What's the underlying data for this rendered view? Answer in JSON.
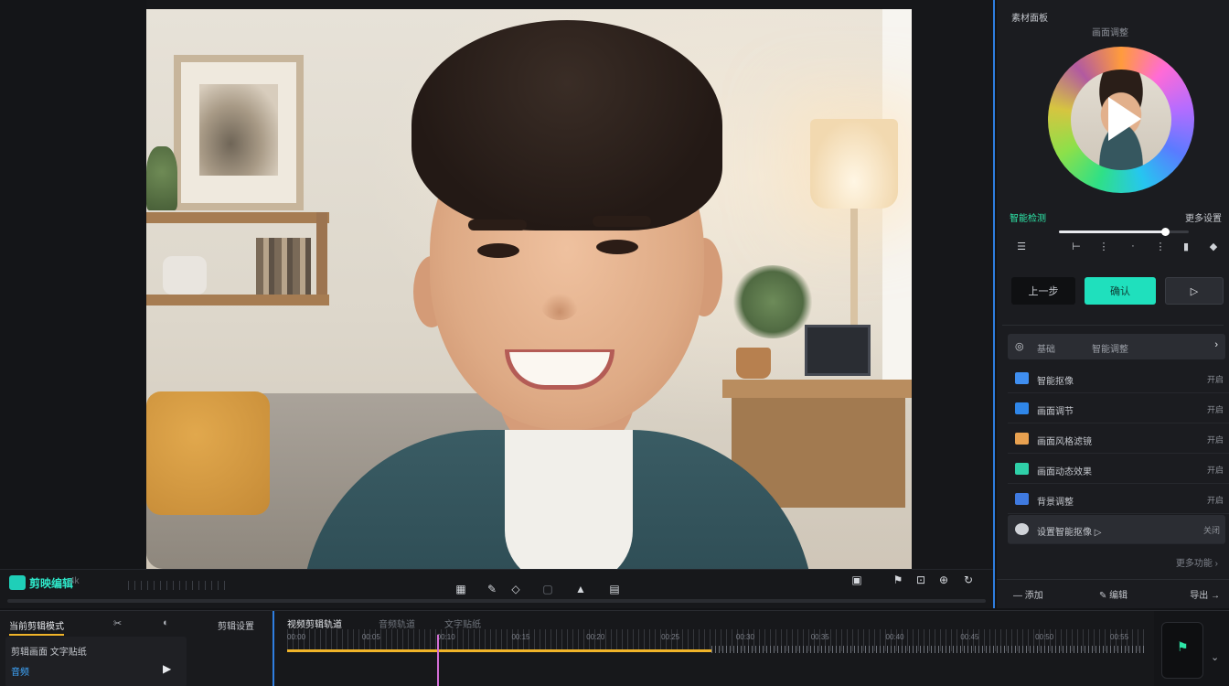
{
  "viewer": {
    "app_title": "剪映编辑",
    "app_sub": "4k",
    "toolbar_icons": [
      "grid-icon",
      "pen-icon",
      "eraser-icon",
      "crop-icon",
      "pointer-icon",
      "export-icon"
    ],
    "right_icons": [
      "screen-icon",
      "flag-icon",
      "fit-icon",
      "zoom-icon",
      "refresh-icon"
    ]
  },
  "panel": {
    "header": "素材面板",
    "subheader": "画面调整",
    "status_left": "智能检测",
    "status_right": "更多设置",
    "slider_value": 0.82,
    "buttons": {
      "left": "上一步",
      "primary": "确认",
      "right": "▷"
    },
    "list_header": {
      "icon": "◎",
      "label": "基础",
      "sub": "智能调整",
      "chevron": "›"
    },
    "items": [
      {
        "label": "智能抠像",
        "value": "开启",
        "color": "#3f8ef0"
      },
      {
        "label": "画面调节",
        "value": "开启",
        "color": "#2f86e8"
      },
      {
        "label": "画面风格滤镜",
        "value": "开启",
        "color": "#e8a150"
      },
      {
        "label": "画面动态效果",
        "value": "开启",
        "color": "#2fd0a8"
      },
      {
        "label": "背景调整",
        "value": "开启",
        "color": "#3f7ae0"
      },
      {
        "label": "设置智能抠像 ▷",
        "value": "关闭",
        "color": "#d0d3d8"
      }
    ],
    "note": "更多功能 ›",
    "footer": {
      "left": "— 添加",
      "middle": "✎ 编辑",
      "right": "导出 →"
    }
  },
  "timeline": {
    "left_title": "当前剪辑模式",
    "left_tool1": "✂",
    "left_tool2": "◐",
    "left_tool3": "剪辑设置",
    "card_line1": "剪辑画面  文字贴纸",
    "card_line2": "音频",
    "tabs": [
      "视频剪辑轨道",
      "音频轨道",
      "文字贴纸"
    ],
    "time_marks": [
      "00:00",
      "00:05",
      "00:10",
      "00:15",
      "00:20",
      "00:25",
      "00:30",
      "00:35",
      "00:40",
      "00:45",
      "00:50",
      "00:55"
    ]
  },
  "colors": {
    "accent": "#1fe0bd",
    "split": "#2f7ee0",
    "timeline_track": "#f0b429",
    "playhead": "#d46ed6"
  }
}
